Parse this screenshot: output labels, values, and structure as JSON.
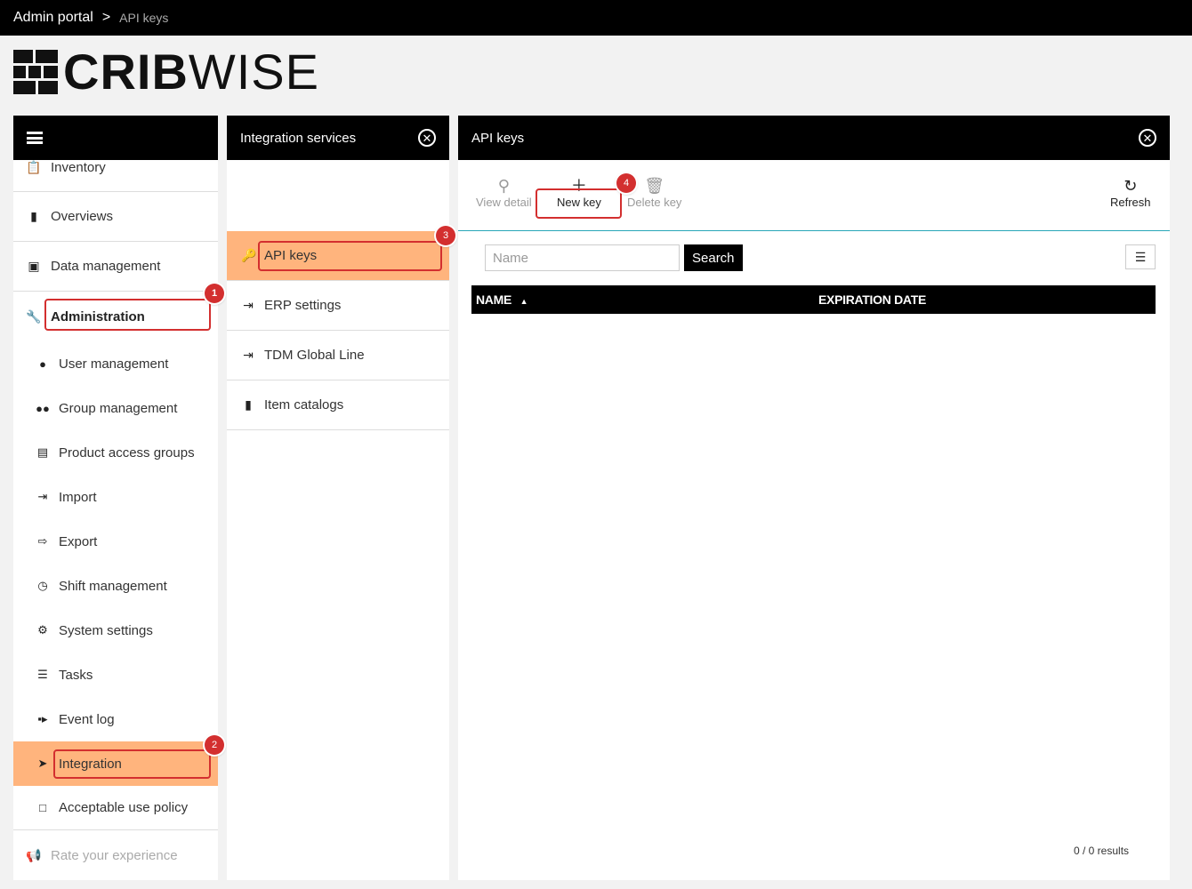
{
  "breadcrumb": {
    "root": "Admin portal",
    "separator": ">",
    "current": "API keys"
  },
  "logo": {
    "bold": "CRIB",
    "light": "WISE"
  },
  "nav": {
    "items": [
      {
        "icon": "clipboard-icon",
        "label": "Inventory"
      },
      {
        "icon": "bar-chart-icon",
        "label": "Overviews"
      },
      {
        "icon": "briefcase-icon",
        "label": "Data management"
      },
      {
        "icon": "wrench-icon",
        "label": "Administration"
      }
    ],
    "sub_items": [
      {
        "icon": "user-icon",
        "label": "User management"
      },
      {
        "icon": "users-icon",
        "label": "Group management"
      },
      {
        "icon": "list-box-icon",
        "label": "Product access groups"
      },
      {
        "icon": "import-icon",
        "label": "Import"
      },
      {
        "icon": "export-icon",
        "label": "Export"
      },
      {
        "icon": "clock-icon",
        "label": "Shift management"
      },
      {
        "icon": "gear-icon",
        "label": "System settings"
      },
      {
        "icon": "list-icon",
        "label": "Tasks"
      },
      {
        "icon": "video-icon",
        "label": "Event log"
      },
      {
        "icon": "paper-plane-icon",
        "label": "Integration"
      },
      {
        "icon": "note-icon",
        "label": "Acceptable use policy"
      }
    ],
    "rate": "Rate your experience"
  },
  "integration": {
    "title": "Integration services",
    "items": [
      {
        "icon": "key-icon",
        "label": "API keys"
      },
      {
        "icon": "file-import-icon",
        "label": "ERP settings"
      },
      {
        "icon": "file-import-icon",
        "label": "TDM Global Line"
      },
      {
        "icon": "book-icon",
        "label": "Item catalogs"
      }
    ]
  },
  "api_keys": {
    "title": "API keys",
    "toolbar": {
      "view_detail": "View detail",
      "new_key": "New key",
      "delete_key": "Delete key",
      "refresh": "Refresh"
    },
    "search": {
      "placeholder": "Name",
      "button": "Search"
    },
    "columns": {
      "name": "NAME",
      "expiration": "EXPIRATION DATE"
    },
    "results": "0 / 0 results"
  },
  "annotations": [
    "1",
    "2",
    "3",
    "4"
  ],
  "colors": {
    "active": "#ffb47d",
    "highlight": "#d32f2f",
    "accent": "#27a6b8"
  }
}
